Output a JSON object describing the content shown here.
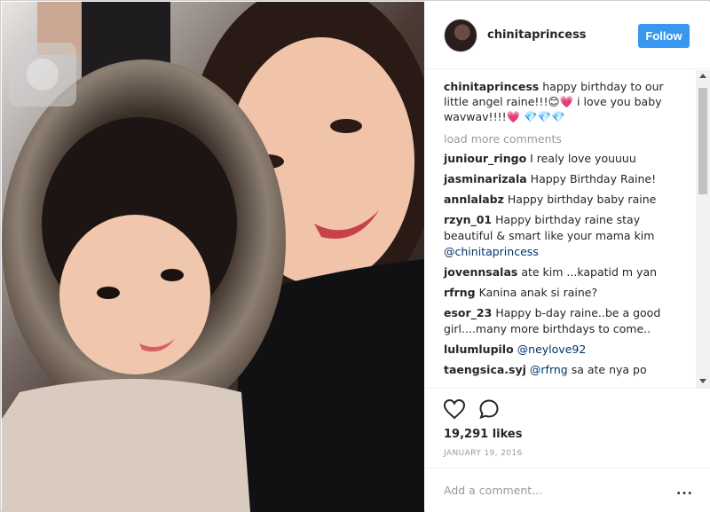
{
  "post": {
    "username": "chinitaprincess",
    "follow_label": "Follow",
    "caption_user": "chinitaprincess",
    "caption_text": "happy birthday to our little angel raine!!!😊💗 i love you baby wavwav!!!!💗 💎💎💎",
    "load_more": "load more comments",
    "comments": [
      {
        "user": "juniour_ringo",
        "text": "I realy love youuuu"
      },
      {
        "user": "jasminarizala",
        "text": "Happy Birthday Raine!"
      },
      {
        "user": "annlalabz",
        "text": "Happy birthday baby raine"
      },
      {
        "user": "rzyn_01",
        "text": "Happy birthday raine stay beautiful & smart like your mama kim ",
        "mention": "@chinitaprincess"
      },
      {
        "user": "jovennsalas",
        "text": "ate kim ...kapatid m yan"
      },
      {
        "user": "rfrng",
        "text": "Kanina anak si raine?"
      },
      {
        "user": "esor_23",
        "text": "Happy b-day raine..be a good girl....many more birthdays to come.."
      },
      {
        "user": "lulumlupilo",
        "text": "",
        "mention": "@neylove92"
      },
      {
        "user": "taengsica.syj",
        "text": " sa ate nya po",
        "mention": "@rfrng"
      }
    ],
    "likes": "19,291 likes",
    "date": "JANUARY 19, 2016",
    "add_comment_placeholder": "Add a comment...",
    "more_label": "...",
    "icons": {
      "like": "heart-icon",
      "comment": "comment-icon",
      "more": "more-options-icon"
    },
    "colors": {
      "follow": "#3897f0",
      "muted": "#999999",
      "mention": "#003569"
    }
  }
}
